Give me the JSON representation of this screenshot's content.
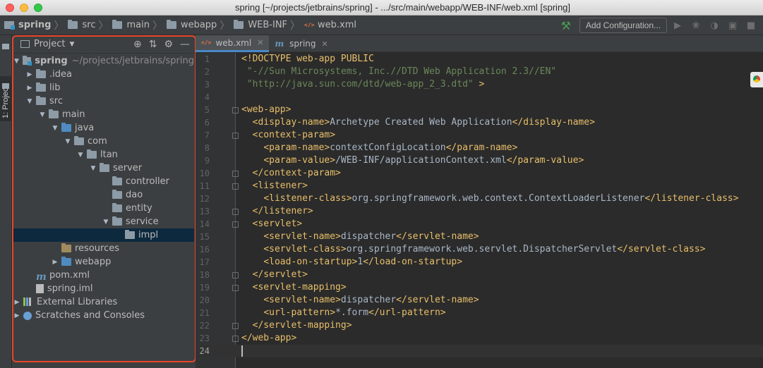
{
  "window": {
    "title": "spring [~/projects/jetbrains/spring] - .../src/main/webapp/WEB-INF/web.xml [spring]"
  },
  "navbar": {
    "breadcrumbs": [
      "spring",
      "src",
      "main",
      "webapp",
      "WEB-INF",
      "web.xml"
    ],
    "add_configuration_label": "Add Configuration..."
  },
  "stripe": {
    "project_tab_label": "1: Project"
  },
  "project_panel": {
    "title": "Project",
    "tree": [
      {
        "label": "spring",
        "suffix": "~/projects/jetbrains/spring",
        "depth": 0,
        "arrow": "down",
        "icon": "module-folder",
        "bold": true
      },
      {
        "label": ".idea",
        "depth": 1,
        "arrow": "right",
        "icon": "folder"
      },
      {
        "label": "lib",
        "depth": 1,
        "arrow": "right",
        "icon": "folder"
      },
      {
        "label": "src",
        "depth": 1,
        "arrow": "down",
        "icon": "folder"
      },
      {
        "label": "main",
        "depth": 2,
        "arrow": "down",
        "icon": "folder"
      },
      {
        "label": "java",
        "depth": 3,
        "arrow": "down",
        "icon": "source-folder"
      },
      {
        "label": "com",
        "depth": 4,
        "arrow": "down",
        "icon": "package"
      },
      {
        "label": "ltan",
        "depth": 5,
        "arrow": "down",
        "icon": "package"
      },
      {
        "label": "server",
        "depth": 6,
        "arrow": "down",
        "icon": "package"
      },
      {
        "label": "controller",
        "depth": 7,
        "arrow": "none",
        "icon": "package"
      },
      {
        "label": "dao",
        "depth": 7,
        "arrow": "none",
        "icon": "package"
      },
      {
        "label": "entity",
        "depth": 7,
        "arrow": "none",
        "icon": "package"
      },
      {
        "label": "service",
        "depth": 7,
        "arrow": "down",
        "icon": "package"
      },
      {
        "label": "impl",
        "depth": 8,
        "arrow": "none",
        "icon": "package",
        "selected": true
      },
      {
        "label": "resources",
        "depth": 3,
        "arrow": "none",
        "icon": "resources-folder"
      },
      {
        "label": "webapp",
        "depth": 3,
        "arrow": "right",
        "icon": "web-folder"
      },
      {
        "label": "pom.xml",
        "depth": 1,
        "arrow": "none",
        "icon": "maven-file"
      },
      {
        "label": "spring.iml",
        "depth": 1,
        "arrow": "none",
        "icon": "iml-file"
      },
      {
        "label": "External Libraries",
        "depth": 0,
        "arrow": "right",
        "icon": "libraries"
      },
      {
        "label": "Scratches and Consoles",
        "depth": 0,
        "arrow": "right",
        "icon": "scratches"
      }
    ]
  },
  "editor": {
    "tabs": [
      {
        "label": "web.xml",
        "icon": "xml-file-icon",
        "active": true
      },
      {
        "label": "spring",
        "icon": "maven-icon",
        "active": false
      }
    ],
    "lines": [
      [
        [
          "t",
          "<!DOCTYPE web-app PUBLIC"
        ]
      ],
      [
        [
          "s",
          " \"-//Sun Microsystems, Inc.//DTD Web Application 2.3//EN\""
        ]
      ],
      [
        [
          "s",
          " \"http://java.sun.com/dtd/web-app_2_3.dtd\""
        ],
        [
          "t",
          " >"
        ]
      ],
      [],
      [
        [
          "t",
          "<web-app>"
        ]
      ],
      [
        [
          "x",
          "  "
        ],
        [
          "t",
          "<display-name>"
        ],
        [
          "x",
          "Archetype Created Web Application"
        ],
        [
          "t",
          "</display-name>"
        ]
      ],
      [
        [
          "x",
          "  "
        ],
        [
          "t",
          "<context-param>"
        ]
      ],
      [
        [
          "x",
          "    "
        ],
        [
          "t",
          "<param-name>"
        ],
        [
          "x",
          "contextConfigLocation"
        ],
        [
          "t",
          "</param-name>"
        ]
      ],
      [
        [
          "x",
          "    "
        ],
        [
          "t",
          "<param-value>"
        ],
        [
          "x",
          "/WEB-INF/applicationContext.xml"
        ],
        [
          "t",
          "</param-value>"
        ]
      ],
      [
        [
          "x",
          "  "
        ],
        [
          "t",
          "</context-param>"
        ]
      ],
      [
        [
          "x",
          "  "
        ],
        [
          "t",
          "<listener>"
        ]
      ],
      [
        [
          "x",
          "    "
        ],
        [
          "t",
          "<listener-class>"
        ],
        [
          "x",
          "org.springframework.web.context.ContextLoaderListener"
        ],
        [
          "t",
          "</listener-class>"
        ]
      ],
      [
        [
          "x",
          "  "
        ],
        [
          "t",
          "</listener>"
        ]
      ],
      [
        [
          "x",
          "  "
        ],
        [
          "t",
          "<servlet>"
        ]
      ],
      [
        [
          "x",
          "    "
        ],
        [
          "t",
          "<servlet-name>"
        ],
        [
          "x",
          "dispatcher"
        ],
        [
          "t",
          "</servlet-name>"
        ]
      ],
      [
        [
          "x",
          "    "
        ],
        [
          "t",
          "<servlet-class>"
        ],
        [
          "x",
          "org.springframework.web.servlet.DispatcherServlet"
        ],
        [
          "t",
          "</servlet-class>"
        ]
      ],
      [
        [
          "x",
          "    "
        ],
        [
          "t",
          "<load-on-startup>"
        ],
        [
          "x",
          "1"
        ],
        [
          "t",
          "</load-on-startup>"
        ]
      ],
      [
        [
          "x",
          "  "
        ],
        [
          "t",
          "</servlet>"
        ]
      ],
      [
        [
          "x",
          "  "
        ],
        [
          "t",
          "<servlet-mapping>"
        ]
      ],
      [
        [
          "x",
          "    "
        ],
        [
          "t",
          "<servlet-name>"
        ],
        [
          "x",
          "dispatcher"
        ],
        [
          "t",
          "</servlet-name>"
        ]
      ],
      [
        [
          "x",
          "    "
        ],
        [
          "t",
          "<url-pattern>"
        ],
        [
          "x",
          "*.form"
        ],
        [
          "t",
          "</url-pattern>"
        ]
      ],
      [
        [
          "x",
          "  "
        ],
        [
          "t",
          "</servlet-mapping>"
        ]
      ],
      [
        [
          "t",
          "</web-app>"
        ]
      ],
      []
    ],
    "fold_lines": [
      5,
      7,
      10,
      11,
      13,
      14,
      18,
      19,
      22,
      23
    ],
    "current_line": 24
  },
  "colors": {
    "highlight_border": "#e8462a",
    "tag": "#e8bf6a",
    "string": "#6a8759",
    "text": "#a9b7c6"
  }
}
